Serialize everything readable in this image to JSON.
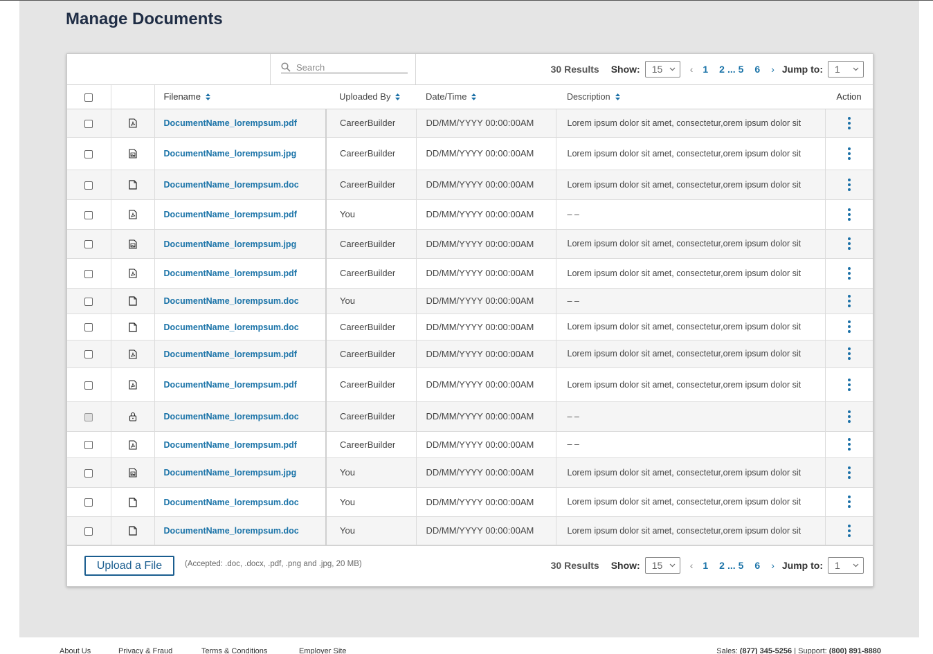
{
  "page": {
    "title": "Manage Documents"
  },
  "search": {
    "placeholder": "Search"
  },
  "pagination": {
    "results": "30 Results",
    "show_label": "Show:",
    "show_value": "15",
    "pages": [
      "1",
      "2",
      "...",
      "5",
      "6"
    ],
    "jump_label": "Jump to:",
    "jump_value": "1"
  },
  "table": {
    "headers": {
      "filename": "Filename",
      "uploaded_by": "Uploaded By",
      "datetime": "Date/Time",
      "description": "Description",
      "action": "Action"
    },
    "rows": [
      {
        "icon": "pdf-file-icon",
        "filename": "DocumentName_lorempsum.pdf",
        "uploaded_by": "CareerBuilder",
        "datetime": "DD/MM/YYYY 00:00:00AM",
        "description": "Lorem ipsum dolor sit amet, consectetur,orem ipsum dolor sit"
      },
      {
        "icon": "image-file-icon",
        "filename": "DocumentName_lorempsum.jpg",
        "uploaded_by": "CareerBuilder",
        "datetime": "DD/MM/YYYY 00:00:00AM",
        "description": "Lorem ipsum dolor sit amet, consectetur,orem ipsum dolor sit"
      },
      {
        "icon": "doc-file-icon",
        "filename": "DocumentName_lorempsum.doc",
        "uploaded_by": "CareerBuilder",
        "datetime": "DD/MM/YYYY 00:00:00AM",
        "description": "Lorem ipsum dolor sit amet, consectetur,orem ipsum dolor sit"
      },
      {
        "icon": "pdf-file-icon",
        "filename": "DocumentName_lorempsum.pdf",
        "uploaded_by": "You",
        "datetime": "DD/MM/YYYY 00:00:00AM",
        "description": "– –"
      },
      {
        "icon": "image-file-icon",
        "filename": "DocumentName_lorempsum.jpg",
        "uploaded_by": "CareerBuilder",
        "datetime": "DD/MM/YYYY 00:00:00AM",
        "description": "Lorem ipsum dolor sit amet, consectetur,orem ipsum dolor sit"
      },
      {
        "icon": "pdf-file-icon",
        "filename": "DocumentName_lorempsum.pdf",
        "uploaded_by": "CareerBuilder",
        "datetime": "DD/MM/YYYY 00:00:00AM",
        "description": "Lorem ipsum dolor sit amet, consectetur,orem ipsum dolor sit"
      },
      {
        "icon": "doc-file-icon",
        "filename": "DocumentName_lorempsum.doc",
        "uploaded_by": "You",
        "datetime": "DD/MM/YYYY 00:00:00AM",
        "description": "– –"
      },
      {
        "icon": "doc-file-icon",
        "filename": "DocumentName_lorempsum.doc",
        "uploaded_by": "CareerBuilder",
        "datetime": "DD/MM/YYYY 00:00:00AM",
        "description": "Lorem ipsum dolor sit amet, consectetur,orem ipsum dolor sit"
      },
      {
        "icon": "pdf-file-icon",
        "filename": "DocumentName_lorempsum.pdf",
        "uploaded_by": "CareerBuilder",
        "datetime": "DD/MM/YYYY 00:00:00AM",
        "description": "Lorem ipsum dolor sit amet, consectetur,orem ipsum dolor sit"
      },
      {
        "icon": "pdf-file-icon",
        "filename": "DocumentName_lorempsum.pdf",
        "uploaded_by": "CareerBuilder",
        "datetime": "DD/MM/YYYY 00:00:00AM",
        "description": "Lorem ipsum dolor sit amet, consectetur,orem ipsum dolor sit"
      },
      {
        "icon": "lock-icon",
        "filename": "DocumentName_lorempsum.doc",
        "uploaded_by": "CareerBuilder",
        "datetime": "DD/MM/YYYY 00:00:00AM",
        "description": "– –",
        "locked": true
      },
      {
        "icon": "pdf-file-icon",
        "filename": "DocumentName_lorempsum.pdf",
        "uploaded_by": "CareerBuilder",
        "datetime": "DD/MM/YYYY 00:00:00AM",
        "description": "– –"
      },
      {
        "icon": "image-file-icon",
        "filename": "DocumentName_lorempsum.jpg",
        "uploaded_by": "You",
        "datetime": "DD/MM/YYYY 00:00:00AM",
        "description": "Lorem ipsum dolor sit amet, consectetur,orem ipsum dolor sit"
      },
      {
        "icon": "doc-file-icon",
        "filename": "DocumentName_lorempsum.doc",
        "uploaded_by": "You",
        "datetime": "DD/MM/YYYY 00:00:00AM",
        "description": "Lorem ipsum dolor sit amet, consectetur,orem ipsum dolor sit"
      },
      {
        "icon": "doc-file-icon",
        "filename": "DocumentName_lorempsum.doc",
        "uploaded_by": "You",
        "datetime": "DD/MM/YYYY 00:00:00AM",
        "description": "Lorem ipsum dolor sit amet, consectetur,orem ipsum dolor sit"
      }
    ]
  },
  "upload": {
    "button_label": "Upload a File",
    "accepted_text": "(Accepted: .doc, .docx, .pdf, .png and .jpg, 20 MB)"
  },
  "footer": {
    "links": [
      "About Us",
      "Privacy & Fraud",
      "Terms & Conditions",
      "Employer Site"
    ],
    "sales_label": "Sales:",
    "sales_phone": "(877) 345-5256",
    "support_label": "Support:",
    "support_phone": "(800) 891-8880"
  },
  "colors": {
    "link": "#1a73a8",
    "title": "#1f2d45",
    "button_border": "#1a5d8f",
    "page_bg": "#e5e5e5"
  }
}
